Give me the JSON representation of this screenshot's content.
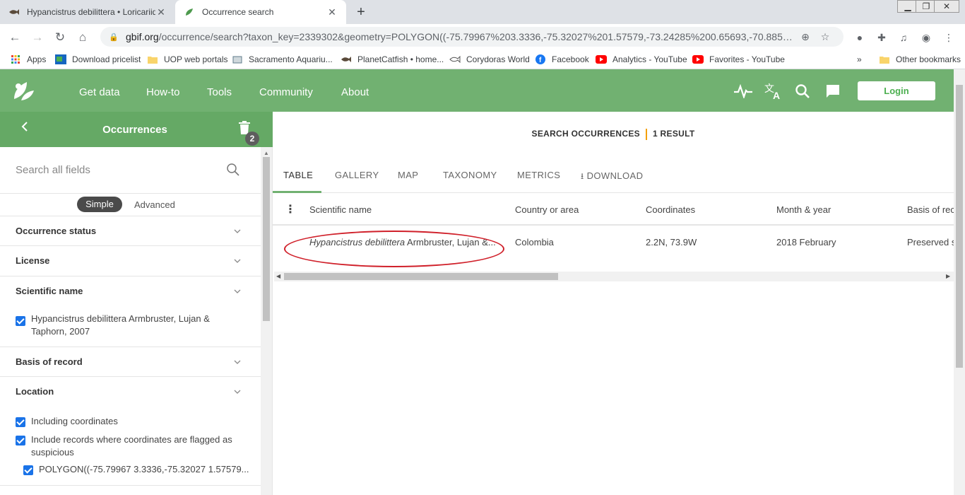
{
  "browser": {
    "tabs": [
      {
        "title": "Hypancistrus debilittera • Loricariidae",
        "favicon": "fish-icon"
      },
      {
        "title": "Occurrence search",
        "favicon": "gbif-leaf-icon"
      }
    ],
    "url_host": "gbif.org",
    "url_path": "/occurrence/search?taxon_key=2339302&geometry=POLYGON((-75.79967%203.3336,-75.32027%201.57579,-73.24285%200.65693,-70.8857...",
    "bookmarks": [
      {
        "label": "Apps",
        "icon": "apps-grid-icon"
      },
      {
        "label": "Download pricelist",
        "icon": "download-pricelist-icon"
      },
      {
        "label": "UOP web portals",
        "icon": "folder-icon"
      },
      {
        "label": "Sacramento Aquariu...",
        "icon": "aquarium-icon"
      },
      {
        "label": "PlanetCatfish • home...",
        "icon": "fish-icon"
      },
      {
        "label": "Corydoras World",
        "icon": "fish-outline-icon"
      },
      {
        "label": "Facebook",
        "icon": "facebook-icon"
      },
      {
        "label": "Analytics - YouTube",
        "icon": "youtube-icon"
      },
      {
        "label": "Favorites - YouTube",
        "icon": "youtube-icon"
      }
    ],
    "bookmarks_more": "»",
    "other_bookmarks": "Other bookmarks"
  },
  "gbif": {
    "nav": [
      "Get data",
      "How-to",
      "Tools",
      "Community",
      "About"
    ],
    "login": "Login",
    "colors": {
      "header": "#71b171",
      "panel_head": "#65a965"
    }
  },
  "sidebar": {
    "title": "Occurrences",
    "filter_count": "2",
    "search_placeholder": "Search all fields",
    "mode_simple": "Simple",
    "mode_advanced": "Advanced",
    "filters": {
      "occurrence_status": "Occurrence status",
      "license": "License",
      "scientific_name": "Scientific name",
      "scientific_name_value_1": "Hypancistrus debilittera Armbruster, Lujan &",
      "scientific_name_value_2": "Taphorn, 2007",
      "basis_of_record": "Basis of record",
      "location": "Location",
      "including_coordinates": "Including coordinates",
      "include_suspicious_1": "Include records where coordinates are flagged as",
      "include_suspicious_2": "suspicious",
      "polygon": "POLYGON((-75.79967 3.3336,-75.32027 1.57579..."
    }
  },
  "results": {
    "label": "SEARCH OCCURRENCES",
    "count": "1 RESULT",
    "tabs": [
      "TABLE",
      "GALLERY",
      "MAP",
      "TAXONOMY",
      "METRICS",
      "DOWNLOAD"
    ],
    "columns": [
      "Scientific name",
      "Country or area",
      "Coordinates",
      "Month & year",
      "Basis of rec"
    ],
    "rows": [
      {
        "name_italic": "Hypancistrus debilittera",
        "name_rest": " Armbruster, Lujan &...",
        "country": "Colombia",
        "coordinates": "2.2N, 73.9W",
        "month_year": "2018 February",
        "basis": "Preserved s"
      }
    ]
  }
}
